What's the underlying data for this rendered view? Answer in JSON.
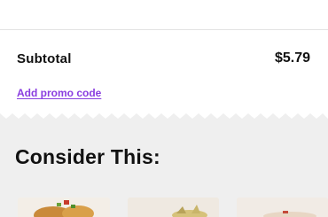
{
  "cart": {
    "subtotal_label": "Subtotal",
    "subtotal_value": "$5.79",
    "promo_link": "Add promo code"
  },
  "consider": {
    "title": "Consider This:",
    "items": [
      {
        "image": "food-item-photo"
      },
      {
        "image": "food-item-photo"
      },
      {
        "image": "food-item-photo"
      }
    ]
  },
  "colors": {
    "accent": "#8a3ee0",
    "section_bg": "#efefef",
    "divider": "#e3e3e3"
  }
}
